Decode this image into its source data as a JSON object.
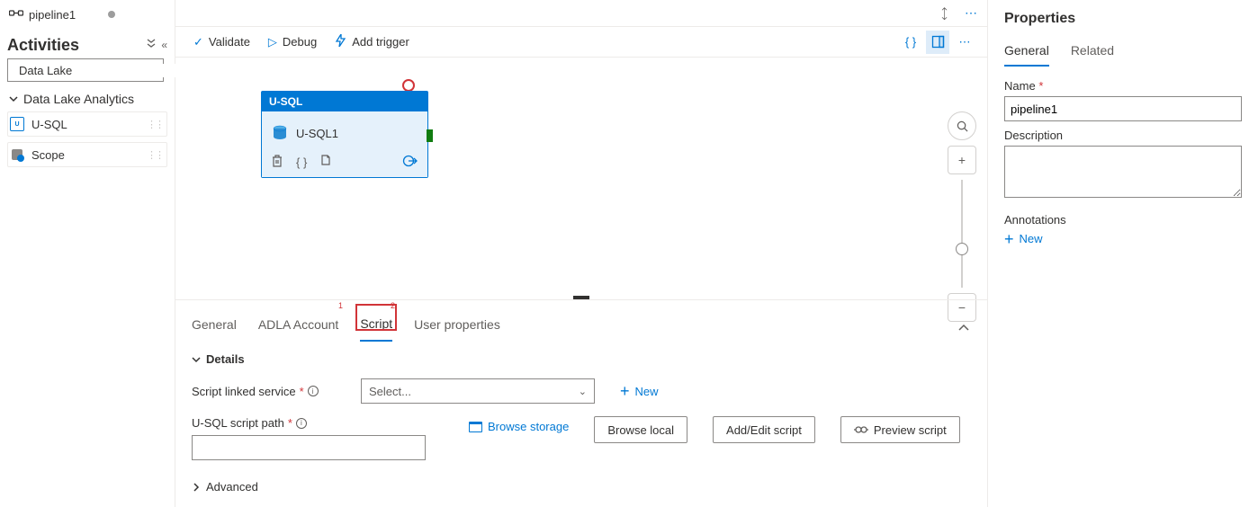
{
  "sidebar": {
    "tab_title": "pipeline1",
    "activities_title": "Activities",
    "search_placeholder": "Data Lake",
    "category": "Data Lake Analytics",
    "items": [
      {
        "label": "U-SQL"
      },
      {
        "label": "Scope"
      }
    ]
  },
  "toolbar": {
    "validate": "Validate",
    "debug": "Debug",
    "add_trigger": "Add trigger"
  },
  "canvas": {
    "activity_type": "U-SQL",
    "activity_name": "U-SQL1"
  },
  "bottom": {
    "tabs": {
      "general": "General",
      "adla": "ADLA Account",
      "script": "Script",
      "user_props": "User properties"
    },
    "callout1": "1",
    "callout2": "2",
    "details": "Details",
    "linked_service_label": "Script linked service",
    "select_placeholder": "Select...",
    "new_label": "New",
    "script_path_label": "U-SQL script path",
    "browse_storage": "Browse storage",
    "browse_local": "Browse local",
    "add_edit": "Add/Edit script",
    "preview": "Preview script",
    "advanced": "Advanced"
  },
  "properties": {
    "title": "Properties",
    "tabs": {
      "general": "General",
      "related": "Related"
    },
    "name_label": "Name",
    "name_value": "pipeline1",
    "description_label": "Description",
    "annotations_label": "Annotations",
    "new_label": "New"
  }
}
